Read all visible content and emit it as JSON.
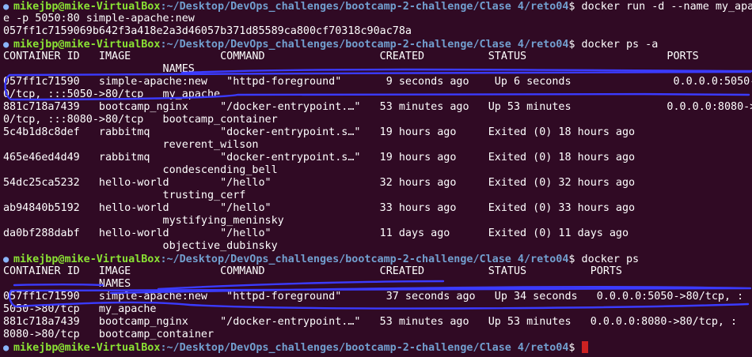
{
  "terminal": {
    "prompt_user": "mikejbp@mike-VirtualBox",
    "prompt_path": ":~/Desktop/DevOps_challenges/bootcamp-2-challenge/Clase 4/reto04",
    "prompt_symbol": "$ ",
    "prompt_mark": "●",
    "accent_color": "#3b3bff",
    "cursor_color": "#cc2222",
    "lines": [
      {
        "type": "prompt",
        "cmd": "docker run -d --name my_apa"
      },
      {
        "type": "output",
        "text": "e -p 5050:80 simple-apache:new"
      },
      {
        "type": "output",
        "text": "057ff1c7159069b642f3a418e2a3d46057b371d85589ca800cf70318c90ac78a"
      },
      {
        "type": "prompt",
        "cmd": "docker ps -a"
      },
      {
        "type": "output",
        "text": "CONTAINER ID   IMAGE              COMMAND                  CREATED          STATUS                      PORTS"
      },
      {
        "type": "output",
        "text": "                         NAMES"
      },
      {
        "type": "output",
        "text": "057ff1c71590   simple-apache:new   \"httpd-foreground\"       9 seconds ago    Up 6 seconds                0.0.0.0:5050->8"
      },
      {
        "type": "output",
        "text": "0/tcp, :::5050->80/tcp   my_apache"
      },
      {
        "type": "output",
        "text": "881c718a7439   bootcamp_nginx     \"/docker-entrypoint.…\"   53 minutes ago   Up 53 minutes               0.0.0.0:8080->8"
      },
      {
        "type": "output",
        "text": "0/tcp, :::8080->80/tcp   bootcamp_container"
      },
      {
        "type": "output",
        "text": "5c4b1d8c8def   rabbitmq           \"docker-entrypoint.s…\"   19 hours ago     Exited (0) 18 hours ago"
      },
      {
        "type": "output",
        "text": "                         reverent_wilson"
      },
      {
        "type": "output",
        "text": "465e46ed4d49   rabbitmq           \"docker-entrypoint.s…\"   19 hours ago     Exited (0) 18 hours ago"
      },
      {
        "type": "output",
        "text": "                         condescending_bell"
      },
      {
        "type": "output",
        "text": "54dc25ca5232   hello-world        \"/hello\"                 32 hours ago     Exited (0) 32 hours ago"
      },
      {
        "type": "output",
        "text": "                         trusting_cerf"
      },
      {
        "type": "output",
        "text": "ab94840b5192   hello-world        \"/hello\"                 33 hours ago     Exited (0) 33 hours ago"
      },
      {
        "type": "output",
        "text": "                         mystifying_meninsky"
      },
      {
        "type": "output",
        "text": "da0bf288dabf   hello-world        \"/hello\"                 11 days ago      Exited (0) 11 days ago"
      },
      {
        "type": "output",
        "text": "                         objective_dubinsky"
      },
      {
        "type": "prompt",
        "cmd": "docker ps"
      },
      {
        "type": "output",
        "text": "CONTAINER ID   IMAGE              COMMAND                  CREATED          STATUS          PORTS"
      },
      {
        "type": "output",
        "text": "               NAMES"
      },
      {
        "type": "output",
        "text": "057ff1c71590   simple-apache:new   \"httpd-foreground\"       37 seconds ago   Up 34 seconds   0.0.0.0:5050->80/tcp, :"
      },
      {
        "type": "output",
        "text": "5050->80/tcp   my_apache"
      },
      {
        "type": "output",
        "text": "881c718a7439   bootcamp_nginx     \"/docker-entrypoint.…\"   53 minutes ago   Up 53 minutes   0.0.0.0:8080->80/tcp, :"
      },
      {
        "type": "output",
        "text": "8080->80/tcp   bootcamp_container"
      },
      {
        "type": "prompt",
        "cmd": "",
        "cursor": true
      }
    ]
  }
}
